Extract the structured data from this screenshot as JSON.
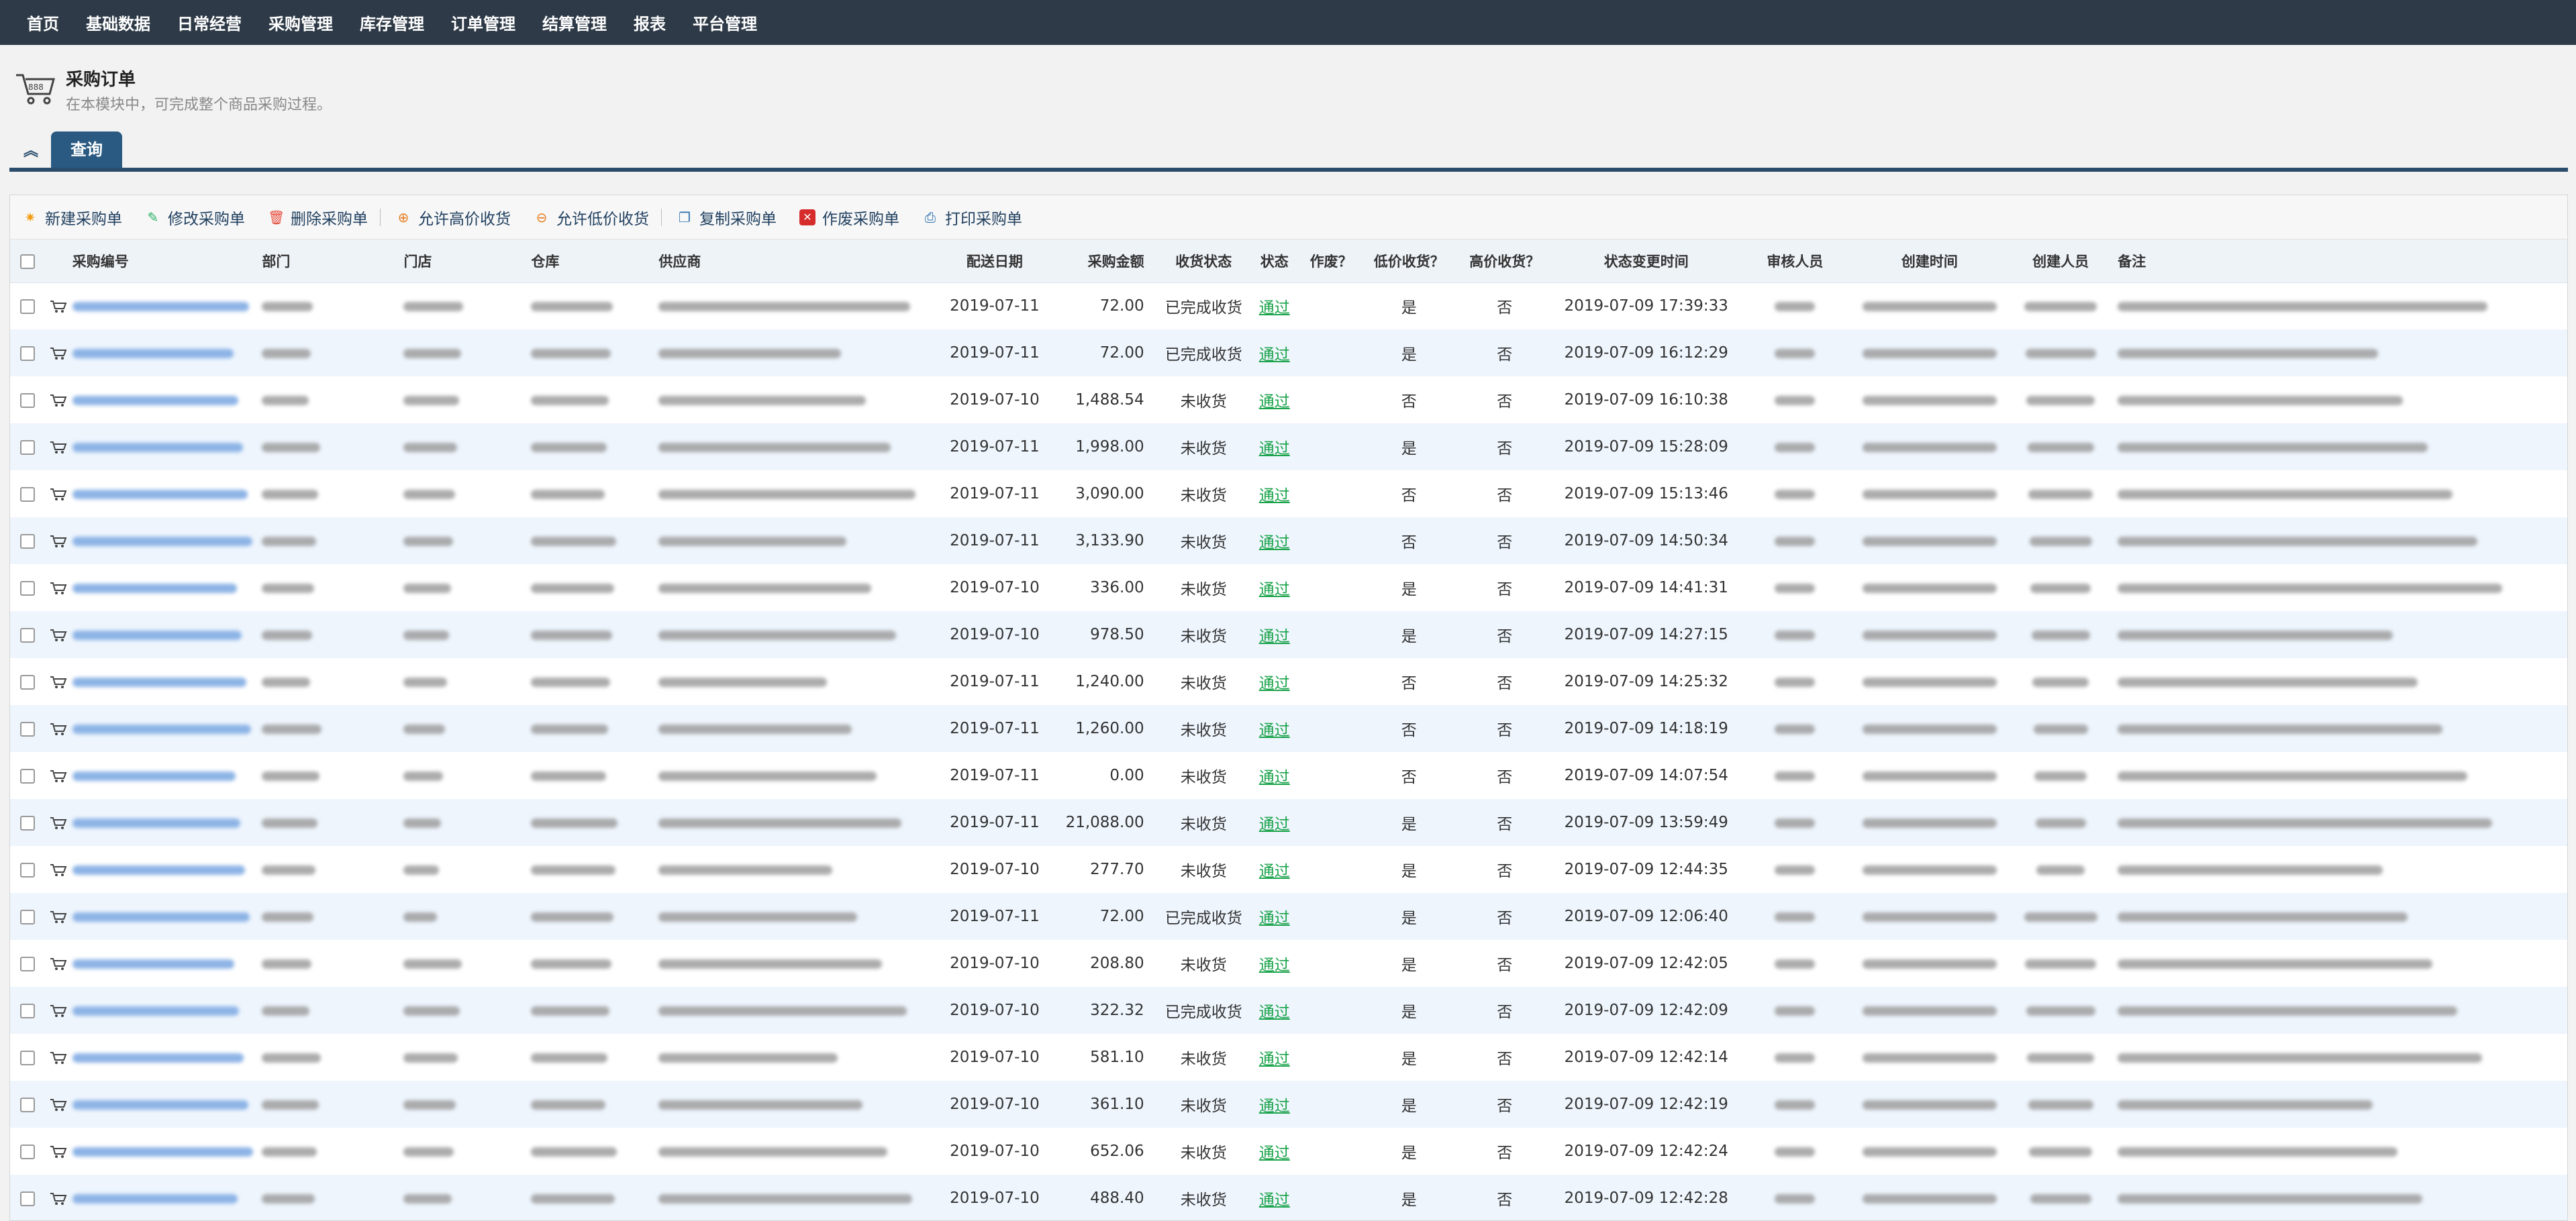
{
  "nav": {
    "items": [
      "首页",
      "基础数据",
      "日常经营",
      "采购管理",
      "库存管理",
      "订单管理",
      "结算管理",
      "报表",
      "平台管理"
    ]
  },
  "header": {
    "title": "采购订单",
    "subtitle": "在本模块中，可完成整个商品采购过程。"
  },
  "tabs": {
    "collapse_icon": "double-chevron-up-icon",
    "active": "查询"
  },
  "toolbar": {
    "new": "新建采购单",
    "edit": "修改采购单",
    "delete": "删除采购单",
    "allow_high": "允许高价收货",
    "allow_low": "允许低价收货",
    "copy": "复制采购单",
    "void": "作废采购单",
    "print": "打印采购单"
  },
  "columns": [
    "采购编号",
    "部门",
    "门店",
    "仓库",
    "供应商",
    "配送日期",
    "采购金额",
    "收货状态",
    "状态",
    "作废？",
    "低价收货？",
    "高价收货？",
    "状态变更时间",
    "审核人员",
    "创建时间",
    "创建人员",
    "备注"
  ],
  "rows": [
    {
      "date": "2019-07-11",
      "amount": "72.00",
      "recv": "已完成收货",
      "status": "通过",
      "low": "是",
      "high": "否",
      "changed": "2019-07-09 17:39:33"
    },
    {
      "date": "2019-07-11",
      "amount": "72.00",
      "recv": "已完成收货",
      "status": "通过",
      "low": "是",
      "high": "否",
      "changed": "2019-07-09 16:12:29"
    },
    {
      "date": "2019-07-10",
      "amount": "1,488.54",
      "recv": "未收货",
      "status": "通过",
      "low": "否",
      "high": "否",
      "changed": "2019-07-09 16:10:38"
    },
    {
      "date": "2019-07-11",
      "amount": "1,998.00",
      "recv": "未收货",
      "status": "通过",
      "low": "是",
      "high": "否",
      "changed": "2019-07-09 15:28:09"
    },
    {
      "date": "2019-07-11",
      "amount": "3,090.00",
      "recv": "未收货",
      "status": "通过",
      "low": "否",
      "high": "否",
      "changed": "2019-07-09 15:13:46"
    },
    {
      "date": "2019-07-11",
      "amount": "3,133.90",
      "recv": "未收货",
      "status": "通过",
      "low": "否",
      "high": "否",
      "changed": "2019-07-09 14:50:34"
    },
    {
      "date": "2019-07-10",
      "amount": "336.00",
      "recv": "未收货",
      "status": "通过",
      "low": "是",
      "high": "否",
      "changed": "2019-07-09 14:41:31"
    },
    {
      "date": "2019-07-10",
      "amount": "978.50",
      "recv": "未收货",
      "status": "通过",
      "low": "是",
      "high": "否",
      "changed": "2019-07-09 14:27:15"
    },
    {
      "date": "2019-07-11",
      "amount": "1,240.00",
      "recv": "未收货",
      "status": "通过",
      "low": "否",
      "high": "否",
      "changed": "2019-07-09 14:25:32"
    },
    {
      "date": "2019-07-11",
      "amount": "1,260.00",
      "recv": "未收货",
      "status": "通过",
      "low": "否",
      "high": "否",
      "changed": "2019-07-09 14:18:19"
    },
    {
      "date": "2019-07-11",
      "amount": "0.00",
      "recv": "未收货",
      "status": "通过",
      "low": "否",
      "high": "否",
      "changed": "2019-07-09 14:07:54"
    },
    {
      "date": "2019-07-11",
      "amount": "21,088.00",
      "recv": "未收货",
      "status": "通过",
      "low": "是",
      "high": "否",
      "changed": "2019-07-09 13:59:49"
    },
    {
      "date": "2019-07-10",
      "amount": "277.70",
      "recv": "未收货",
      "status": "通过",
      "low": "是",
      "high": "否",
      "changed": "2019-07-09 12:44:35"
    },
    {
      "date": "2019-07-11",
      "amount": "72.00",
      "recv": "已完成收货",
      "status": "通过",
      "low": "是",
      "high": "否",
      "changed": "2019-07-09 12:06:40"
    },
    {
      "date": "2019-07-10",
      "amount": "208.80",
      "recv": "未收货",
      "status": "通过",
      "low": "是",
      "high": "否",
      "changed": "2019-07-09 12:42:05"
    },
    {
      "date": "2019-07-10",
      "amount": "322.32",
      "recv": "已完成收货",
      "status": "通过",
      "low": "是",
      "high": "否",
      "changed": "2019-07-09 12:42:09"
    },
    {
      "date": "2019-07-10",
      "amount": "581.10",
      "recv": "未收货",
      "status": "通过",
      "low": "是",
      "high": "否",
      "changed": "2019-07-09 12:42:14"
    },
    {
      "date": "2019-07-10",
      "amount": "361.10",
      "recv": "未收货",
      "status": "通过",
      "low": "是",
      "high": "否",
      "changed": "2019-07-09 12:42:19"
    },
    {
      "date": "2019-07-10",
      "amount": "652.06",
      "recv": "未收货",
      "status": "通过",
      "low": "是",
      "high": "否",
      "changed": "2019-07-09 12:42:24"
    },
    {
      "date": "2019-07-10",
      "amount": "488.40",
      "recv": "未收货",
      "status": "通过",
      "low": "是",
      "high": "否",
      "changed": "2019-07-09 12:42:28"
    }
  ],
  "colors": {
    "nav_bg": "#2e3a47",
    "accent": "#2a5a82",
    "pass": "#1aa34a",
    "row_alt": "#eef5fd"
  }
}
